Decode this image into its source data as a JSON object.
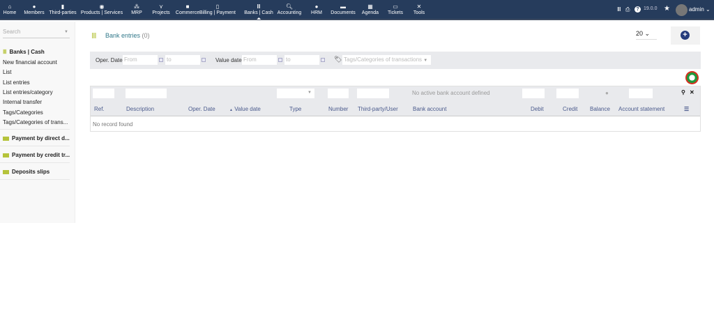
{
  "topbar": {
    "menus": [
      {
        "label": "Home",
        "icon": "home-icon"
      },
      {
        "label": "Members",
        "icon": "user-icon"
      },
      {
        "label": "Third-parties",
        "icon": "building-icon"
      },
      {
        "label": "Products | Services",
        "icon": "cube-icon"
      },
      {
        "label": "MRP",
        "icon": "cubes-icon"
      },
      {
        "label": "Projects",
        "icon": "sitemap-icon"
      },
      {
        "label": "Commerce",
        "icon": "suitcase-icon"
      },
      {
        "label": "Billing | Payment",
        "icon": "file-invoice-icon"
      },
      {
        "label": "Banks | Cash",
        "icon": "bank-icon"
      },
      {
        "label": "Accounting",
        "icon": "search-dollar-icon"
      },
      {
        "label": "HRM",
        "icon": "user-tie-icon"
      },
      {
        "label": "Documents",
        "icon": "folder-icon"
      },
      {
        "label": "Agenda",
        "icon": "calendar-icon"
      },
      {
        "label": "Tickets",
        "icon": "ticket-icon"
      },
      {
        "label": "Tools",
        "icon": "tools-icon"
      }
    ],
    "active": "Banks | Cash",
    "version": "19.0.0",
    "user": "admin"
  },
  "sidebar": {
    "search_placeholder": "Search",
    "section": "Banks | Cash",
    "items": [
      "New financial account",
      "List",
      "List entries",
      "List entries/category",
      "Internal transfer",
      "Tags/Categories",
      "Tags/Categories of trans..."
    ],
    "groups": [
      "Payment by direct d...",
      "Payment by credit tr...",
      "Deposits slips"
    ]
  },
  "main": {
    "title": "Bank entries",
    "count": "(0)",
    "limit": "20",
    "filters": {
      "oper_date": "Oper. Date",
      "from": "From",
      "to": "to",
      "value_date": "Value date",
      "tags_placeholder": "Tags/Categories of transactions"
    },
    "no_account": "No active bank account defined",
    "columns": [
      "Ref.",
      "Description",
      "Oper. Date",
      "Value date",
      "Type",
      "Number",
      "Third-party/User",
      "Bank account",
      "Debit",
      "Credit",
      "Balance",
      "Account statement"
    ],
    "sort_column": "Value date",
    "empty": "No record found"
  },
  "colors": {
    "topbar": "#263c5c",
    "accent": "#b5c33b",
    "header_text": "#4a5a8c"
  }
}
